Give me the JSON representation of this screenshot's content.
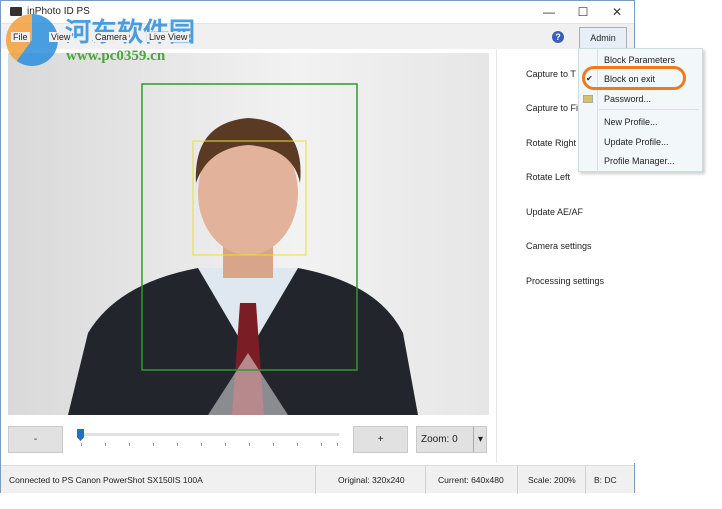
{
  "window": {
    "title": "inPhoto ID PS",
    "minimize": "—",
    "maximize": "☐",
    "close": "✕"
  },
  "menu": [
    "File",
    "View",
    "Camera",
    "Live View"
  ],
  "toolbar": {
    "help": "?",
    "admin": "Admin"
  },
  "right_panel": [
    "Capture to T",
    "Capture to Fi",
    "Rotate Right",
    "Rotate Left",
    "Update AE/AF",
    "Camera settings",
    "Processing settings"
  ],
  "admin_menu": {
    "items": [
      "Block Parameters",
      "Block on exit",
      "Password...",
      "New Profile...",
      "Update Profile...",
      "Profile Manager..."
    ],
    "checked": "Block on exit",
    "check_mark": "✔"
  },
  "controls": {
    "minus": "-",
    "plus": "+",
    "zoom": "Zoom: 0",
    "zoom_arrow": "▾",
    "slider_value": 0
  },
  "status": {
    "connection": "Connected to PS Canon PowerShot SX150IS 100A",
    "original": "Original: 320x240",
    "current": "Current: 640x480",
    "scale": "Scale: 200%",
    "b": "B: DC"
  },
  "watermark": {
    "name": "河东软件园",
    "url": "www.pc0359.cn"
  },
  "colors": {
    "face_frame": "#2e9a2e",
    "eye_frame": "#e8e030",
    "highlight": "#ee7a1c"
  }
}
